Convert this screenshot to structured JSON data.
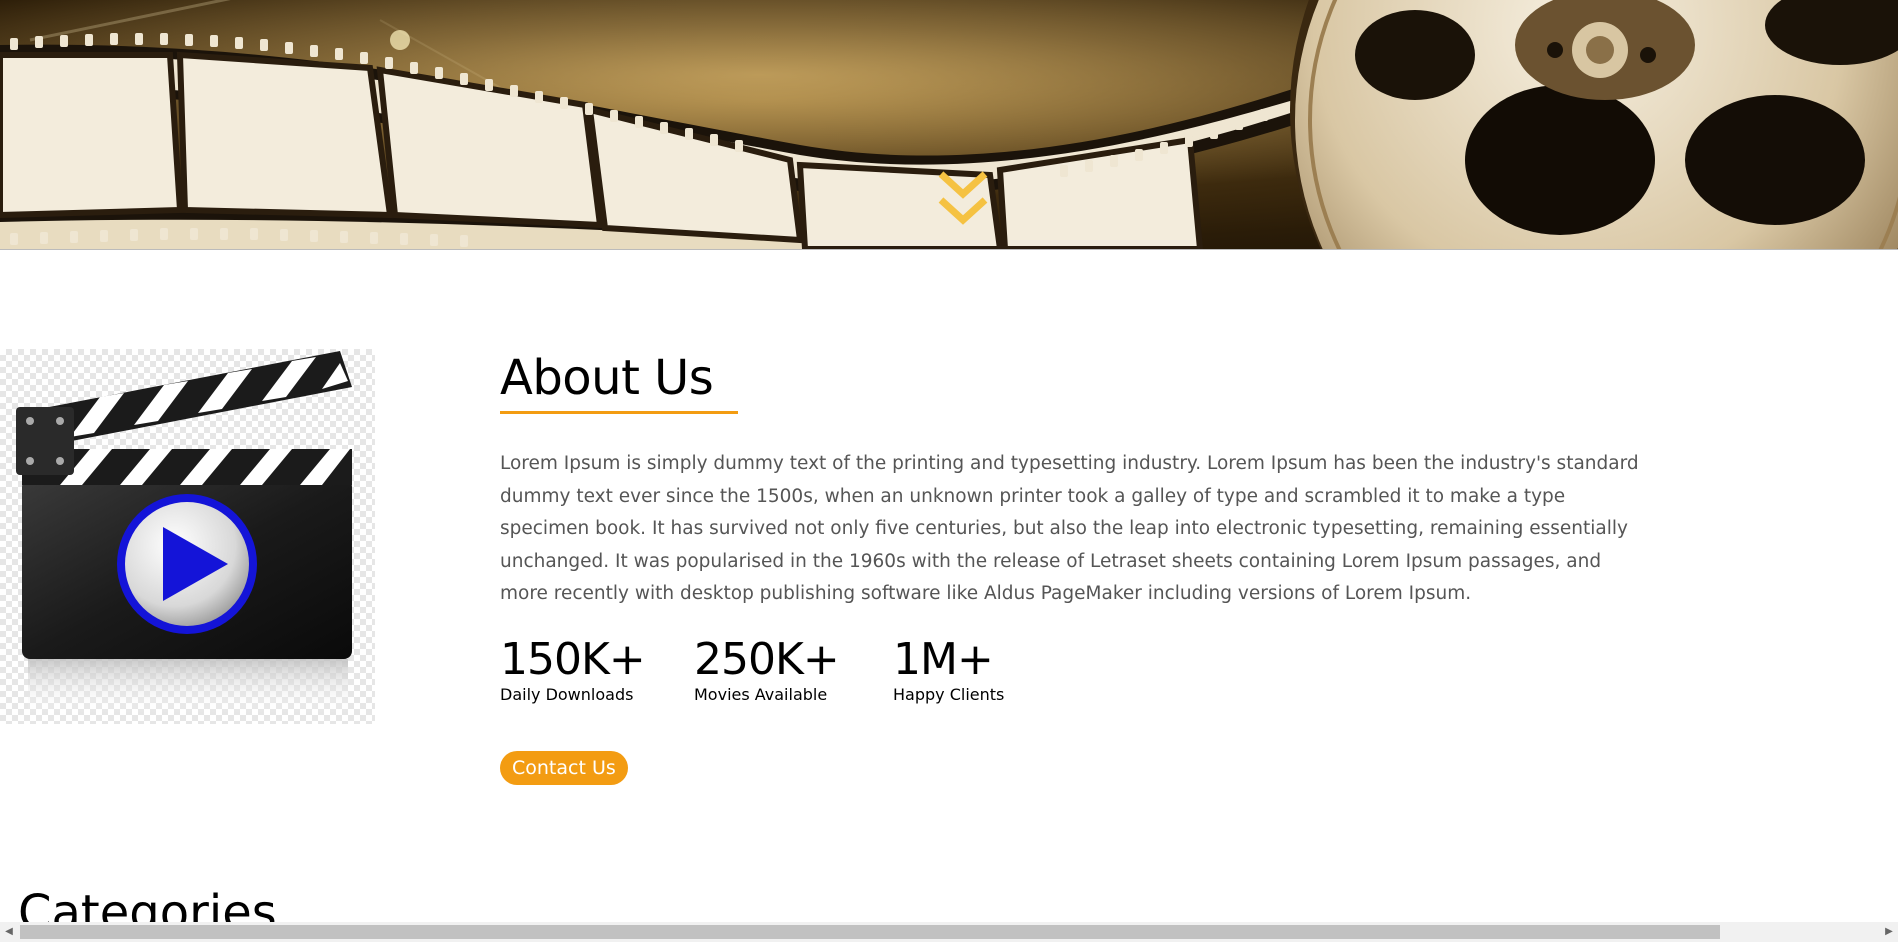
{
  "hero": {
    "scroll_icon": "double-chevron-down-icon",
    "accent": "#f5c242"
  },
  "about": {
    "title": "About Us",
    "body": "Lorem Ipsum is simply dummy text of the printing and typesetting industry. Lorem Ipsum has been the industry's standard dummy text ever since the 1500s, when an unknown printer took a galley of type and scrambled it to make a type specimen book. It has survived not only five centuries, but also the leap into electronic typesetting, remaining essentially unchanged. It was popularised in the 1960s with the release of Letraset sheets containing Lorem Ipsum passages, and more recently with desktop publishing software like Aldus PageMaker including versions of Lorem Ipsum.",
    "image_icon": "clapperboard-play-icon",
    "stats": [
      {
        "value": "150K+",
        "label": "Daily Downloads"
      },
      {
        "value": "250K+",
        "label": "Movies Available"
      },
      {
        "value": "1M+",
        "label": "Happy Clients"
      }
    ],
    "contact_label": "Contact Us",
    "accent": "#f39c12"
  },
  "categories": {
    "title": "Categories"
  },
  "scrollbar": {
    "left_arrow": "◀",
    "right_arrow": "▶"
  }
}
